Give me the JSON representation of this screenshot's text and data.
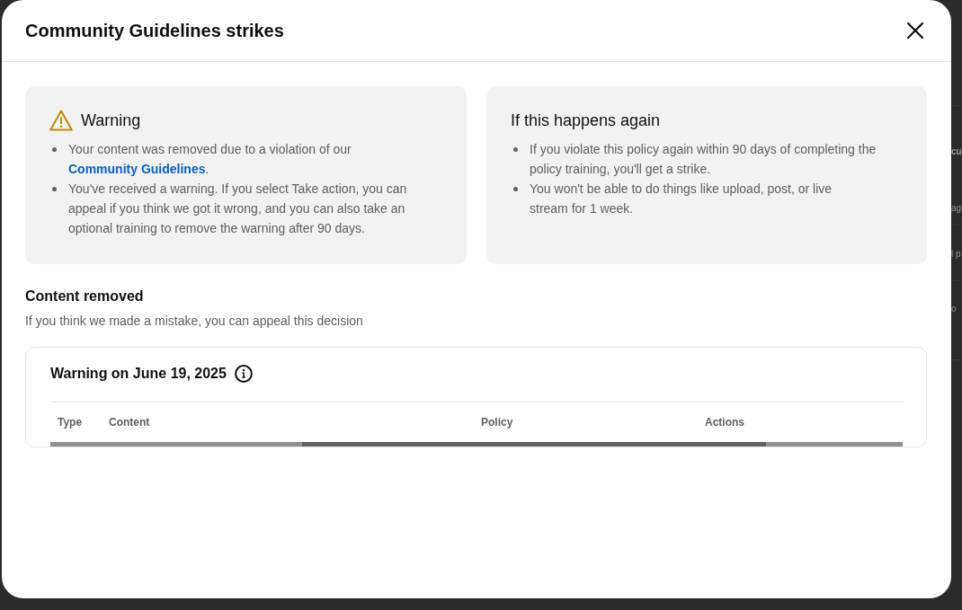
{
  "dialog": {
    "title": "Community Guidelines strikes",
    "notice_cards": [
      {
        "kind": "warning",
        "title": "Warning",
        "bullets": [
          {
            "parts": [
              {
                "kind": "text",
                "text": "Your content was removed due to a violation of our "
              },
              {
                "kind": "link",
                "text": "Community Guidelines"
              },
              {
                "kind": "text",
                "text": "."
              }
            ]
          },
          {
            "parts": [
              {
                "kind": "text",
                "text": "You've received a warning. If you select Take action, you can appeal if you think we got it wrong, and you can also take an optional training to remove the warning after 90 days."
              }
            ]
          }
        ]
      },
      {
        "kind": "info",
        "title": "If this happens again",
        "bullets": [
          {
            "parts": [
              {
                "kind": "text",
                "text": "If you violate this policy again within 90 days of completing the policy training, you'll get a strike."
              }
            ]
          },
          {
            "parts": [
              {
                "kind": "text",
                "text": "You won't be able to do things like upload, post, or live stream for 1 week."
              }
            ]
          }
        ]
      }
    ],
    "content_removed": {
      "title": "Content removed",
      "subtitle": "If you think we made a mistake, you can appeal this decision",
      "strike": {
        "title": "Warning on June 19, 2025",
        "table": {
          "columns": [
            "Type",
            "Content",
            "Policy",
            "Actions"
          ]
        }
      }
    }
  },
  "background_page": {
    "rows": [
      {
        "title": "cu",
        "text": "ag"
      },
      {
        "text": "l p"
      },
      {
        "text": "o"
      }
    ]
  }
}
